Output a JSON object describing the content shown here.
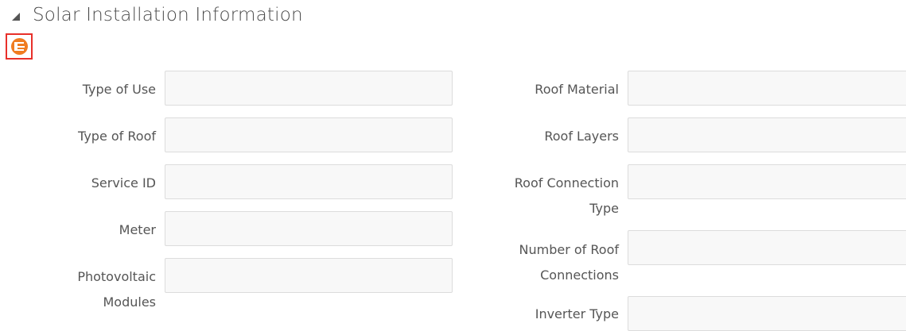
{
  "section": {
    "title": "Solar Installation Information"
  },
  "toolbar": {
    "edit_icon": "edit-icon"
  },
  "fields_left": [
    {
      "label": "Type of Use",
      "value": ""
    },
    {
      "label": "Type of Roof",
      "value": ""
    },
    {
      "label": "Service ID",
      "value": ""
    },
    {
      "label": "Meter",
      "value": ""
    },
    {
      "label": "Photovoltaic Modules",
      "value": ""
    }
  ],
  "fields_right": [
    {
      "label": "Roof Material",
      "value": ""
    },
    {
      "label": "Roof Layers",
      "value": ""
    },
    {
      "label": "Roof Connection Type",
      "value": ""
    },
    {
      "label": "Number of Roof Connections",
      "value": ""
    },
    {
      "label": "Inverter Type",
      "value": ""
    }
  ],
  "colors": {
    "accent_orange": "#f07c21",
    "highlight_red": "#e8302a",
    "input_border": "#dcdcdc",
    "input_bg": "#f8f8f8"
  }
}
